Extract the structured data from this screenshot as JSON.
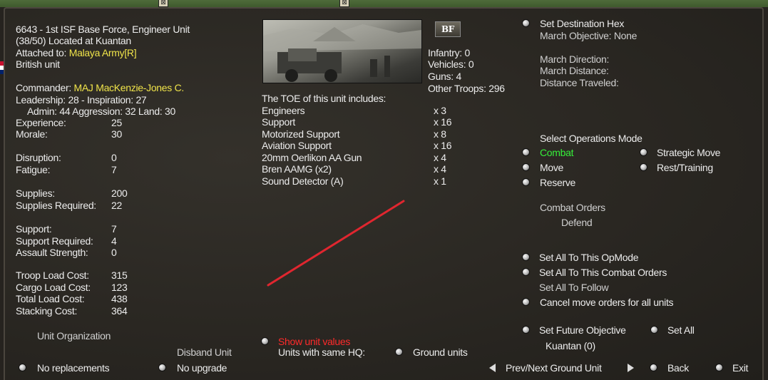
{
  "unit": {
    "title": "6643 - 1st ISF Base Force, Engineer Unit",
    "location": "(38/50) Located at Kuantan",
    "attached_label": "Attached to:",
    "attached_value": "Malaya Army[R]",
    "nationality": "British unit"
  },
  "commander": {
    "label": "Commander:",
    "name": "MAJ MacKenzie-Jones C.",
    "leadership_line": "Leadership: 28 - Inspiration: 27",
    "ratings_line": "Admin: 44  Aggression: 32  Land: 30"
  },
  "stats": [
    {
      "label": "Experience:",
      "value": "25"
    },
    {
      "label": "Morale:",
      "value": "30"
    },
    {
      "label": "Disruption:",
      "value": "0"
    },
    {
      "label": "Fatigue:",
      "value": "7"
    },
    {
      "label": "Supplies:",
      "value": "200"
    },
    {
      "label": "Supplies Required:",
      "value": "22"
    },
    {
      "label": "Support:",
      "value": "7"
    },
    {
      "label": "Support Required:",
      "value": "4"
    },
    {
      "label": "Assault Strength:",
      "value": "0"
    },
    {
      "label": "Troop Load Cost:",
      "value": "315"
    },
    {
      "label": "Cargo Load Cost:",
      "value": "123"
    },
    {
      "label": "Total Load Cost:",
      "value": "438"
    },
    {
      "label": "Stacking Cost:",
      "value": "364"
    }
  ],
  "bottom_left": {
    "unit_organization": "Unit Organization",
    "disband_unit": "Disband Unit",
    "no_replacements": "No replacements",
    "no_upgrade": "No upgrade"
  },
  "badge": "BF",
  "counts": {
    "infantry": "Infantry: 0",
    "vehicles": "Vehicles: 0",
    "guns": "Guns: 4",
    "other": "Other Troops: 296"
  },
  "toe": {
    "heading": "The TOE of this unit includes:",
    "items": [
      {
        "name": "Engineers",
        "qty": "x 3"
      },
      {
        "name": "Support",
        "qty": "x 16"
      },
      {
        "name": "Motorized Support",
        "qty": "x 8"
      },
      {
        "name": "Aviation Support",
        "qty": "x 16"
      },
      {
        "name": "20mm Oerlikon AA Gun",
        "qty": "x 4"
      },
      {
        "name": "Bren AAMG (x2)",
        "qty": "x 4"
      },
      {
        "name": "Sound Detector (A)",
        "qty": "x 1"
      }
    ]
  },
  "center_bottom": {
    "show_unit_values": "Show unit values",
    "units_same_hq": "Units with same HQ:",
    "ground_units": "Ground units"
  },
  "right": {
    "set_destination": "Set Destination Hex",
    "march_objective": "March Objective: None",
    "march_direction": "March Direction:",
    "march_distance": "March Distance:",
    "distance_traveled": "Distance Traveled:",
    "ops_heading": "Select Operations Mode",
    "modes": {
      "combat": "Combat",
      "move": "Move",
      "reserve": "Reserve",
      "strategic_move": "Strategic Move",
      "rest_training": "Rest/Training"
    },
    "combat_orders_label": "Combat Orders",
    "combat_orders_value": "Defend",
    "set_all_opmode": "Set All To This OpMode",
    "set_all_orders": "Set All To This Combat Orders",
    "set_all_follow": "Set All To Follow",
    "cancel_move": "Cancel move orders for all units",
    "set_future_objective": "Set Future Objective",
    "set_all": "Set All",
    "future_target": "Kuantan (0)",
    "prev_next": "Prev/Next Ground Unit",
    "back": "Back",
    "exit": "Exit"
  },
  "colors": {
    "highlight_yellow": "#f0e44a",
    "active_green": "#36f03a",
    "warning_red": "#ff2a2a",
    "annotation_line": "#e0262f"
  }
}
